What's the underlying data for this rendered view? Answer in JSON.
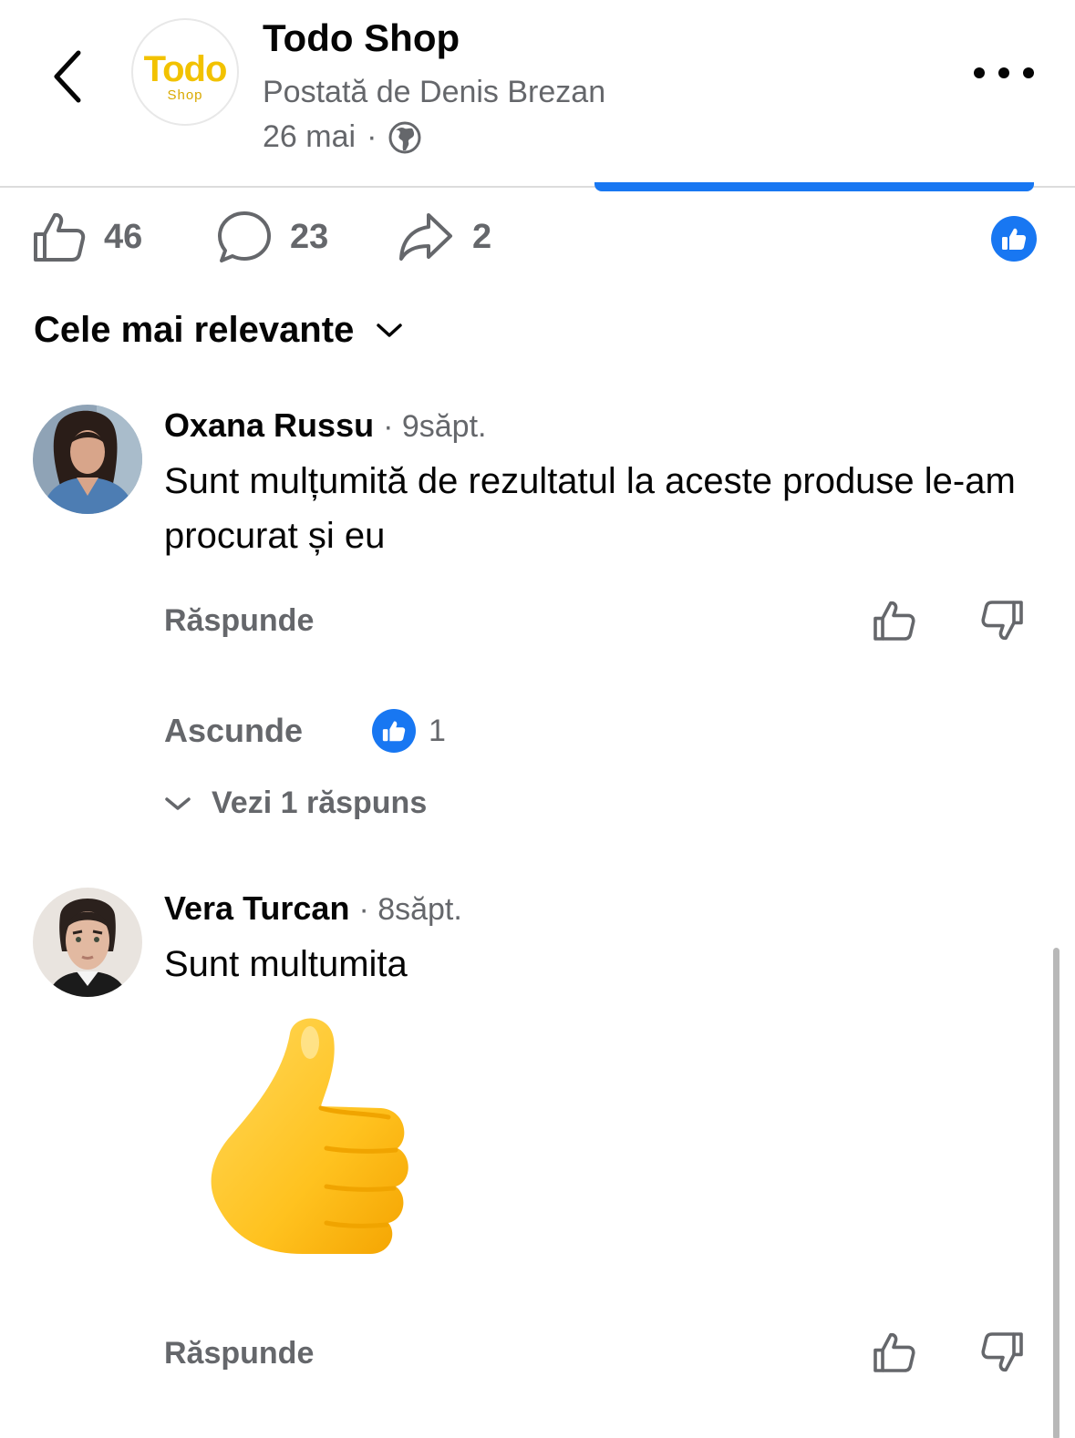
{
  "header": {
    "page_name": "Todo Shop",
    "logo_word": "Todo",
    "logo_sub": "Shop",
    "posted_by": "Postată de Denis Brezan",
    "date": "26 mai",
    "separator": "·",
    "icons": {
      "back": "chevron-left-icon",
      "privacy": "globe-icon",
      "more": "more-dots-icon"
    }
  },
  "stats": {
    "likes": "46",
    "comments": "23",
    "shares": "2",
    "icons": {
      "like": "thumbs-up-icon",
      "comment": "comment-bubble-icon",
      "share": "share-arrow-icon"
    }
  },
  "sort": {
    "label": "Cele mai relevante"
  },
  "comments": [
    {
      "author": "Oxana Russu",
      "time": "· 9săpt.",
      "text": "Sunt mulțumită de rezultatul la aceste produse le-am procurat și eu",
      "reply_label": "Răspunde",
      "hide_label": "Ascunde",
      "reaction_count": "1",
      "see_replies_label": "Vezi 1 răspuns"
    },
    {
      "author": "Vera Turcan",
      "time": "· 8săpt.",
      "text": "Sunt multumita",
      "reply_label": "Răspunde",
      "sticker": "thumbs-up-emoji"
    }
  ],
  "colors": {
    "brand_blue": "#1877f2",
    "secondary_text": "#65676b",
    "logo_yellow": "#f2c200",
    "emoji_yellow": "#ffc83d"
  }
}
